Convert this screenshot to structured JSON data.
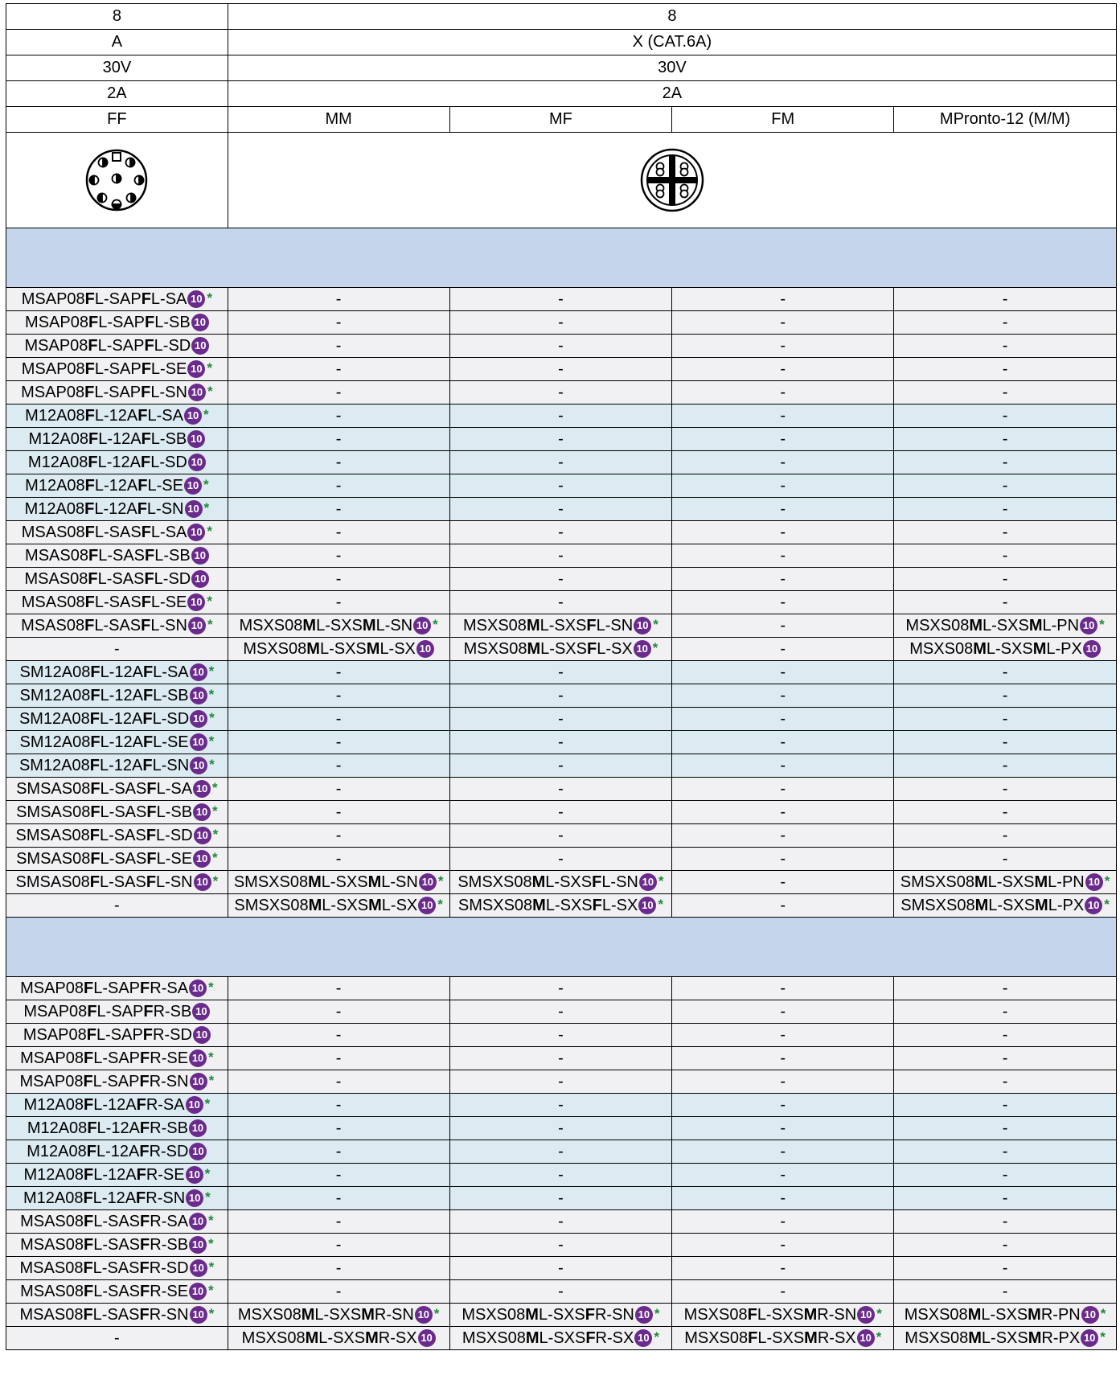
{
  "header_rows": [
    {
      "left": "8",
      "right": "8"
    },
    {
      "left": "A",
      "right": "X (CAT.6A)"
    },
    {
      "left": "30V",
      "right": "30V"
    },
    {
      "left": "2A",
      "right": "2A"
    }
  ],
  "gender_row": [
    "FF",
    "MM",
    "MF",
    "FM",
    "MPronto-12 (M/M)"
  ],
  "badge_text": "10",
  "star_text": "*",
  "colors": {
    "band": "#c5d5eb",
    "gray_row": "#f1f1f3",
    "blue_row": "#dceaf1",
    "badge": "#6a2b8c",
    "star": "#1f8a3a"
  },
  "icons": [
    "m12-a-coded-8pin-connector-icon",
    "m12-x-coded-connector-icon"
  ],
  "sections": [
    {
      "rows": [
        {
          "s": "g",
          "c": [
            [
              "MSAP08",
              "FL-SAP",
              "FL-SA",
              1
            ],
            "-",
            "-",
            "-",
            "-"
          ]
        },
        {
          "s": "g",
          "c": [
            [
              "MSAP08",
              "FL-SAP",
              "FL-SB",
              0
            ],
            "-",
            "-",
            "-",
            "-"
          ]
        },
        {
          "s": "g",
          "c": [
            [
              "MSAP08",
              "FL-SAP",
              "FL-SD",
              0
            ],
            "-",
            "-",
            "-",
            "-"
          ]
        },
        {
          "s": "g",
          "c": [
            [
              "MSAP08",
              "FL-SAP",
              "FL-SE",
              1
            ],
            "-",
            "-",
            "-",
            "-"
          ]
        },
        {
          "s": "g",
          "c": [
            [
              "MSAP08",
              "FL-SAP",
              "FL-SN",
              1
            ],
            "-",
            "-",
            "-",
            "-"
          ]
        },
        {
          "s": "b",
          "c": [
            [
              "M12A08",
              "FL-12A",
              "FL-SA",
              1
            ],
            "-",
            "-",
            "-",
            "-"
          ]
        },
        {
          "s": "b",
          "c": [
            [
              "M12A08",
              "FL-12A",
              "FL-SB",
              0
            ],
            "-",
            "-",
            "-",
            "-"
          ]
        },
        {
          "s": "b",
          "c": [
            [
              "M12A08",
              "FL-12A",
              "FL-SD",
              0
            ],
            "-",
            "-",
            "-",
            "-"
          ]
        },
        {
          "s": "b",
          "c": [
            [
              "M12A08",
              "FL-12A",
              "FL-SE",
              1
            ],
            "-",
            "-",
            "-",
            "-"
          ]
        },
        {
          "s": "b",
          "c": [
            [
              "M12A08",
              "FL-12A",
              "FL-SN",
              1
            ],
            "-",
            "-",
            "-",
            "-"
          ]
        },
        {
          "s": "g",
          "c": [
            [
              "MSAS08",
              "FL-SAS",
              "FL-SA",
              1
            ],
            "-",
            "-",
            "-",
            "-"
          ]
        },
        {
          "s": "g",
          "c": [
            [
              "MSAS08",
              "FL-SAS",
              "FL-SB",
              0
            ],
            "-",
            "-",
            "-",
            "-"
          ]
        },
        {
          "s": "g",
          "c": [
            [
              "MSAS08",
              "FL-SAS",
              "FL-SD",
              0
            ],
            "-",
            "-",
            "-",
            "-"
          ]
        },
        {
          "s": "g",
          "c": [
            [
              "MSAS08",
              "FL-SAS",
              "FL-SE",
              1
            ],
            "-",
            "-",
            "-",
            "-"
          ]
        },
        {
          "s": "g",
          "c": [
            [
              "MSAS08",
              "FL-SAS",
              "FL-SN",
              1
            ],
            [
              "MSXS08",
              "ML-SXS",
              "ML-SN",
              1
            ],
            [
              "MSXS08",
              "ML-SXS",
              "FL-SN",
              1
            ],
            "-",
            [
              "MSXS08",
              "ML-SXS",
              "ML-PN",
              1
            ]
          ]
        },
        {
          "s": "g",
          "c": [
            "-",
            [
              "MSXS08",
              "ML-SXS",
              "ML-SX",
              0
            ],
            [
              "MSXS08",
              "ML-SXS",
              "FL-SX",
              1
            ],
            "-",
            [
              "MSXS08",
              "ML-SXS",
              "ML-PX",
              0
            ]
          ]
        },
        {
          "s": "b",
          "c": [
            [
              "SM12A08",
              "FL-12A",
              "FL-SA",
              1
            ],
            "-",
            "-",
            "-",
            "-"
          ]
        },
        {
          "s": "b",
          "c": [
            [
              "SM12A08",
              "FL-12A",
              "FL-SB",
              1
            ],
            "-",
            "-",
            "-",
            "-"
          ]
        },
        {
          "s": "b",
          "c": [
            [
              "SM12A08",
              "FL-12A",
              "FL-SD",
              1
            ],
            "-",
            "-",
            "-",
            "-"
          ]
        },
        {
          "s": "b",
          "c": [
            [
              "SM12A08",
              "FL-12A",
              "FL-SE",
              1
            ],
            "-",
            "-",
            "-",
            "-"
          ]
        },
        {
          "s": "b",
          "c": [
            [
              "SM12A08",
              "FL-12A",
              "FL-SN",
              1
            ],
            "-",
            "-",
            "-",
            "-"
          ]
        },
        {
          "s": "g",
          "c": [
            [
              "SMSAS08",
              "FL-SAS",
              "FL-SA",
              1
            ],
            "-",
            "-",
            "-",
            "-"
          ]
        },
        {
          "s": "g",
          "c": [
            [
              "SMSAS08",
              "FL-SAS",
              "FL-SB",
              1
            ],
            "-",
            "-",
            "-",
            "-"
          ]
        },
        {
          "s": "g",
          "c": [
            [
              "SMSAS08",
              "FL-SAS",
              "FL-SD",
              1
            ],
            "-",
            "-",
            "-",
            "-"
          ]
        },
        {
          "s": "g",
          "c": [
            [
              "SMSAS08",
              "FL-SAS",
              "FL-SE",
              1
            ],
            "-",
            "-",
            "-",
            "-"
          ]
        },
        {
          "s": "g",
          "c": [
            [
              "SMSAS08",
              "FL-SAS",
              "FL-SN",
              1
            ],
            [
              "SMSXS08",
              "ML-SXS",
              "ML-SN",
              1
            ],
            [
              "SMSXS08",
              "ML-SXS",
              "FL-SN",
              1
            ],
            "-",
            [
              "SMSXS08",
              "ML-SXS",
              "ML-PN",
              1
            ]
          ]
        },
        {
          "s": "g",
          "c": [
            "-",
            [
              "SMSXS08",
              "ML-SXS",
              "ML-SX",
              1
            ],
            [
              "SMSXS08",
              "ML-SXS",
              "FL-SX",
              1
            ],
            "-",
            [
              "SMSXS08",
              "ML-SXS",
              "ML-PX",
              1
            ]
          ]
        }
      ]
    },
    {
      "rows": [
        {
          "s": "g",
          "c": [
            [
              "MSAP08",
              "FL-SAP",
              "FR-SA",
              1
            ],
            "-",
            "-",
            "-",
            "-"
          ]
        },
        {
          "s": "g",
          "c": [
            [
              "MSAP08",
              "FL-SAP",
              "FR-SB",
              0
            ],
            "-",
            "-",
            "-",
            "-"
          ]
        },
        {
          "s": "g",
          "c": [
            [
              "MSAP08",
              "FL-SAP",
              "FR-SD",
              0
            ],
            "-",
            "-",
            "-",
            "-"
          ]
        },
        {
          "s": "g",
          "c": [
            [
              "MSAP08",
              "FL-SAP",
              "FR-SE",
              1
            ],
            "-",
            "-",
            "-",
            "-"
          ]
        },
        {
          "s": "g",
          "c": [
            [
              "MSAP08",
              "FL-SAP",
              "FR-SN",
              1
            ],
            "-",
            "-",
            "-",
            "-"
          ]
        },
        {
          "s": "b",
          "c": [
            [
              "M12A08",
              "FL-12A",
              "FR-SA",
              1
            ],
            "-",
            "-",
            "-",
            "-"
          ]
        },
        {
          "s": "b",
          "c": [
            [
              "M12A08",
              "FL-12A",
              "FR-SB",
              0
            ],
            "-",
            "-",
            "-",
            "-"
          ]
        },
        {
          "s": "b",
          "c": [
            [
              "M12A08",
              "FL-12A",
              "FR-SD",
              0
            ],
            "-",
            "-",
            "-",
            "-"
          ]
        },
        {
          "s": "b",
          "c": [
            [
              "M12A08",
              "FL-12A",
              "FR-SE",
              1
            ],
            "-",
            "-",
            "-",
            "-"
          ]
        },
        {
          "s": "b",
          "c": [
            [
              "M12A08",
              "FL-12A",
              "FR-SN",
              1
            ],
            "-",
            "-",
            "-",
            "-"
          ]
        },
        {
          "s": "g",
          "c": [
            [
              "MSAS08",
              "FL-SAS",
              "FR-SA",
              1
            ],
            "-",
            "-",
            "-",
            "-"
          ]
        },
        {
          "s": "g",
          "c": [
            [
              "MSAS08",
              "FL-SAS",
              "FR-SB",
              1
            ],
            "-",
            "-",
            "-",
            "-"
          ]
        },
        {
          "s": "g",
          "c": [
            [
              "MSAS08",
              "FL-SAS",
              "FR-SD",
              1
            ],
            "-",
            "-",
            "-",
            "-"
          ]
        },
        {
          "s": "g",
          "c": [
            [
              "MSAS08",
              "FL-SAS",
              "FR-SE",
              1
            ],
            "-",
            "-",
            "-",
            "-"
          ]
        },
        {
          "s": "g",
          "c": [
            [
              "MSAS08",
              "FL-SAS",
              "FR-SN",
              1
            ],
            [
              "MSXS08",
              "ML-SXS",
              "MR-SN",
              1
            ],
            [
              "MSXS08",
              "ML-SXS",
              "FR-SN",
              1
            ],
            [
              "MSXS08",
              "FL-SXS",
              "MR-SN",
              1
            ],
            [
              "MSXS08",
              "ML-SXS",
              "MR-PN",
              1
            ]
          ]
        },
        {
          "s": "g",
          "c": [
            "-",
            [
              "MSXS08",
              "ML-SXS",
              "MR-SX",
              0
            ],
            [
              "MSXS08",
              "ML-SXS",
              "FR-SX",
              1
            ],
            [
              "MSXS08",
              "FL-SXS",
              "MR-SX",
              1
            ],
            [
              "MSXS08",
              "ML-SXS",
              "MR-PX",
              1
            ]
          ]
        }
      ]
    }
  ]
}
